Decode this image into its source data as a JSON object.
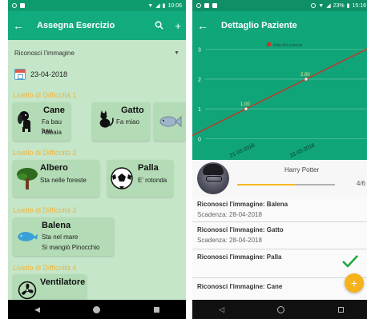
{
  "left": {
    "status": {
      "time": "10:06"
    },
    "app_bar": {
      "title": "Assegna Esercizio"
    },
    "spinner": {
      "value": "Riconosci l'immagine"
    },
    "date": "23-04-2018",
    "levels": [
      {
        "label": "Livello di Difficoltà 1"
      },
      {
        "label": "Livello di Difficoltà 2"
      },
      {
        "label": "Livello di Difficoltà 3"
      },
      {
        "label": "Livello di Difficoltà 4"
      }
    ],
    "cards": [
      {
        "name": "Cane",
        "desc1": "Fa bau bau",
        "desc2": "Abbaia",
        "icon": "dog-icon"
      },
      {
        "name": "Gatto",
        "desc1": "Fa miao",
        "desc2": "",
        "icon": "cat-icon"
      },
      {
        "name": "",
        "desc1": "",
        "desc2": "",
        "icon": "fish-icon"
      },
      {
        "name": "Albero",
        "desc1": "Sta nelle foreste",
        "desc2": "",
        "icon": "tree-icon"
      },
      {
        "name": "Palla",
        "desc1": "E' rotonda",
        "desc2": "",
        "icon": "soccer-ball-icon"
      },
      {
        "name": "Balena",
        "desc1": "Sta nel mare",
        "desc2": "Si mangiò Pinocchio",
        "icon": "whale-icon"
      },
      {
        "name": "Ventilatore",
        "desc1": "",
        "desc2": "",
        "icon": "fan-icon"
      }
    ]
  },
  "right": {
    "status": {
      "battery": "23%",
      "time": "15:16"
    },
    "app_bar": {
      "title": "Dettaglio Paziente"
    },
    "patient": {
      "name": "Harry Potter",
      "progress": 0.6,
      "progress_text": "4/6"
    },
    "exercises": [
      {
        "label": "Riconosci l'immagine: Balena",
        "due": "Scadenza: 28-04-2018"
      },
      {
        "label": "Riconosci l'immagine: Gatto",
        "due": "Scadenza: 28-04-2018"
      },
      {
        "label": "Riconosci l'immagine: Palla",
        "due": ""
      },
      {
        "label": "Riconosci l'immagine: Cane",
        "due": ""
      }
    ],
    "colors": {
      "accent": "#f6b21a",
      "primary": "#11a57a",
      "check": "#1fa63a"
    }
  },
  "chart_data": {
    "type": "line",
    "legend": "Voto dei esercizi",
    "x": [
      "21-03-2018",
      "22-03-2018"
    ],
    "series": [
      {
        "values": [
          1.0,
          2.0
        ],
        "labels": [
          "1.00",
          "2.00"
        ]
      }
    ],
    "ylim": [
      -0.5,
      3.1
    ],
    "yticks": [
      0,
      1,
      2,
      3
    ],
    "line_color": "#c0392b",
    "grid": true
  }
}
